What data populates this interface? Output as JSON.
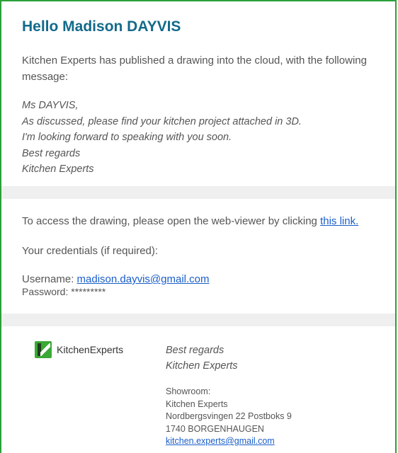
{
  "header": {
    "title": "Hello Madison DAYVIS"
  },
  "intro": "Kitchen Experts has published a drawing into the cloud, with the following message:",
  "message": {
    "lines": [
      "Ms DAYVIS,",
      "As discussed, please find your kitchen project attached in 3D.",
      "I'm looking forward to speaking with you soon.",
      "Best regards",
      "Kitchen Experts"
    ]
  },
  "access": {
    "text": "To access the drawing, please open the web-viewer by clicking ",
    "link_label": "this link.",
    "credentials_heading": "Your credentials (if required):",
    "username_label": "Username: ",
    "username_value": "madison.dayvis@gmail.com",
    "password_label": "Password: ",
    "password_value": "*********"
  },
  "footer": {
    "logo_text": "KitchenExperts",
    "sign_lines": [
      "Best regards",
      "Kitchen Experts"
    ],
    "showroom_label": "Showroom:",
    "showroom_name": "Kitchen Experts",
    "address_line1": "Nordbergsvingen 22 Postboks 9",
    "address_line2": "1740 BORGENHAUGEN",
    "email": "kitchen.experts@gmail.com"
  },
  "colors": {
    "title": "#136a8a",
    "border": "#2aa03a",
    "link": "#1a5ec9",
    "divider": "#efefef"
  }
}
